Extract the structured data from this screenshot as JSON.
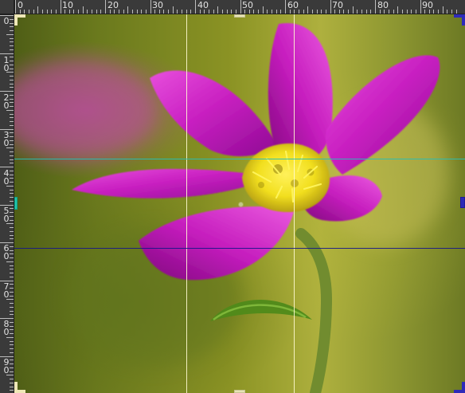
{
  "ruler": {
    "top_labels": [
      "0",
      "10",
      "20",
      "30",
      "40",
      "50",
      "60",
      "70",
      "80",
      "90"
    ],
    "left_labels": [
      "0",
      "1\n0",
      "2\n0",
      "3\n0",
      "4\n0",
      "5\n0",
      "6\n0",
      "7\n0",
      "8\n0",
      "9\n0"
    ]
  },
  "colors": {
    "ruler_bg": "#3a3a3a",
    "guide_vertical": "#fffbd2",
    "guide_horizontal": "#161689",
    "guide_accent": "#29bdb5",
    "flower_petal": "#cf27c8",
    "flower_center": "#f2e11d",
    "stem": "#6e8a2e"
  },
  "canvas": {
    "content": "photo",
    "subject_icon": "flower-icon"
  }
}
